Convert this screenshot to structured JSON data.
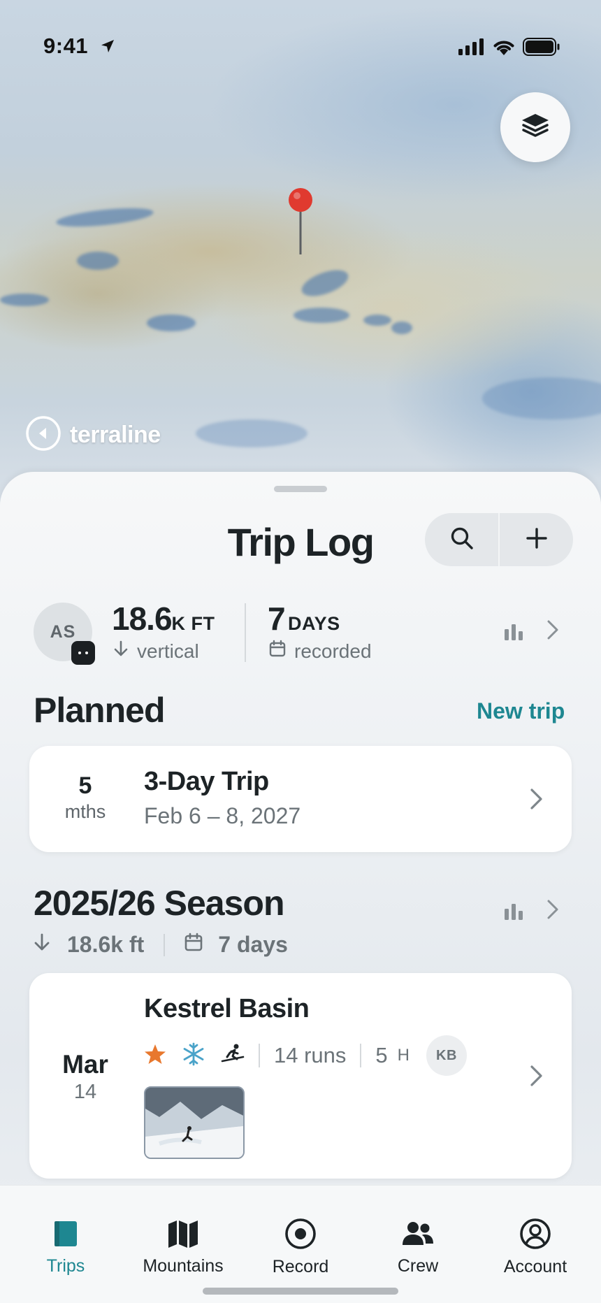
{
  "status_bar": {
    "time": "9:41"
  },
  "map": {
    "brand": "terraline"
  },
  "sheet": {
    "title": "Trip Log",
    "stats": {
      "avatar_initials": "AS",
      "vertical_value": "18.6",
      "vertical_unit": "K FT",
      "vertical_label": "vertical",
      "days_value": "7",
      "days_unit": "DAYS",
      "days_label": "recorded"
    },
    "planned": {
      "heading": "Planned",
      "action": "New trip",
      "trip": {
        "countdown_value": "5",
        "countdown_unit": "mths",
        "title": "3-Day Trip",
        "dates": "Feb 6 – 8, 2027"
      }
    },
    "season": {
      "heading": "2025/26 Season",
      "vertical": "18.6k ft",
      "days": "7 days",
      "trip": {
        "month": "Mar",
        "day": "14",
        "title": "Kestrel Basin",
        "runs": "14 runs",
        "hours_value": "5",
        "hours_unit": "H",
        "crew_initials": "KB"
      }
    }
  },
  "tabs": [
    {
      "label": "Trips",
      "icon": "trips-icon",
      "active": true
    },
    {
      "label": "Mountains",
      "icon": "map-icon"
    },
    {
      "label": "Record",
      "icon": "record-icon"
    },
    {
      "label": "Crew",
      "icon": "crew-icon"
    },
    {
      "label": "Account",
      "icon": "account-icon"
    }
  ],
  "colors": {
    "accent": "#1e8791",
    "pin": "#e03a2f",
    "star": "#e8782e",
    "snowflake": "#4aa3c9"
  }
}
